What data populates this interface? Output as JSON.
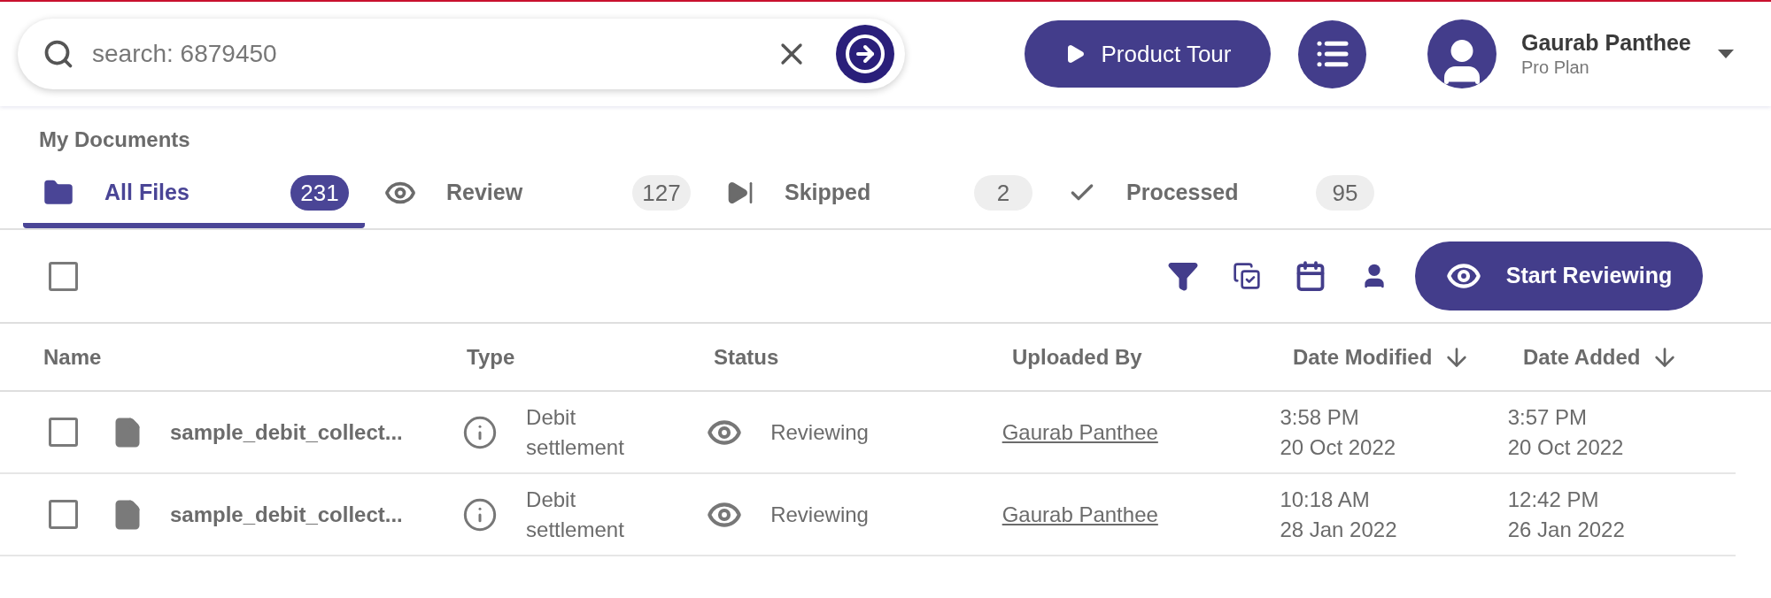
{
  "search": {
    "value": "search: 6879450"
  },
  "header": {
    "tour_button": "Product Tour",
    "user": {
      "name": "Gaurab Panthee",
      "plan": "Pro Plan"
    }
  },
  "section_title": "My Documents",
  "tabs": [
    {
      "kind": "folder",
      "label": "All Files",
      "count": "231",
      "selected": true
    },
    {
      "kind": "eye",
      "label": "Review",
      "count": "127",
      "selected": false
    },
    {
      "kind": "skip",
      "label": "Skipped",
      "count": "2",
      "selected": false
    },
    {
      "kind": "check",
      "label": "Processed",
      "count": "95",
      "selected": false
    }
  ],
  "toolbar": {
    "select_all_checked": false,
    "action_button": "Start Reviewing"
  },
  "table": {
    "columns": [
      {
        "label": "Name",
        "sorted": false
      },
      {
        "label": "Type",
        "sorted": false
      },
      {
        "label": "Status",
        "sorted": false
      },
      {
        "label": "Uploaded By",
        "sorted": false
      },
      {
        "label": "Date Modified",
        "sorted": true
      },
      {
        "label": "Date Added",
        "sorted": true
      }
    ],
    "rows": [
      {
        "checked": false,
        "name": "sample_debit_collect...",
        "type": "Debit settlement",
        "status": "Reviewing",
        "uploaded_by": "Gaurab Panthee",
        "date_modified": [
          "3:58 PM",
          "20 Oct 2022"
        ],
        "date_added": [
          "3:57 PM",
          "20 Oct 2022"
        ]
      },
      {
        "checked": false,
        "name": "sample_debit_collect...",
        "type": "Debit settlement",
        "status": "Reviewing",
        "uploaded_by": "Gaurab Panthee",
        "date_modified": [
          "10:18 AM",
          "28 Jan 2022"
        ],
        "date_added": [
          "12:42 PM",
          "26 Jan 2022"
        ]
      }
    ]
  }
}
